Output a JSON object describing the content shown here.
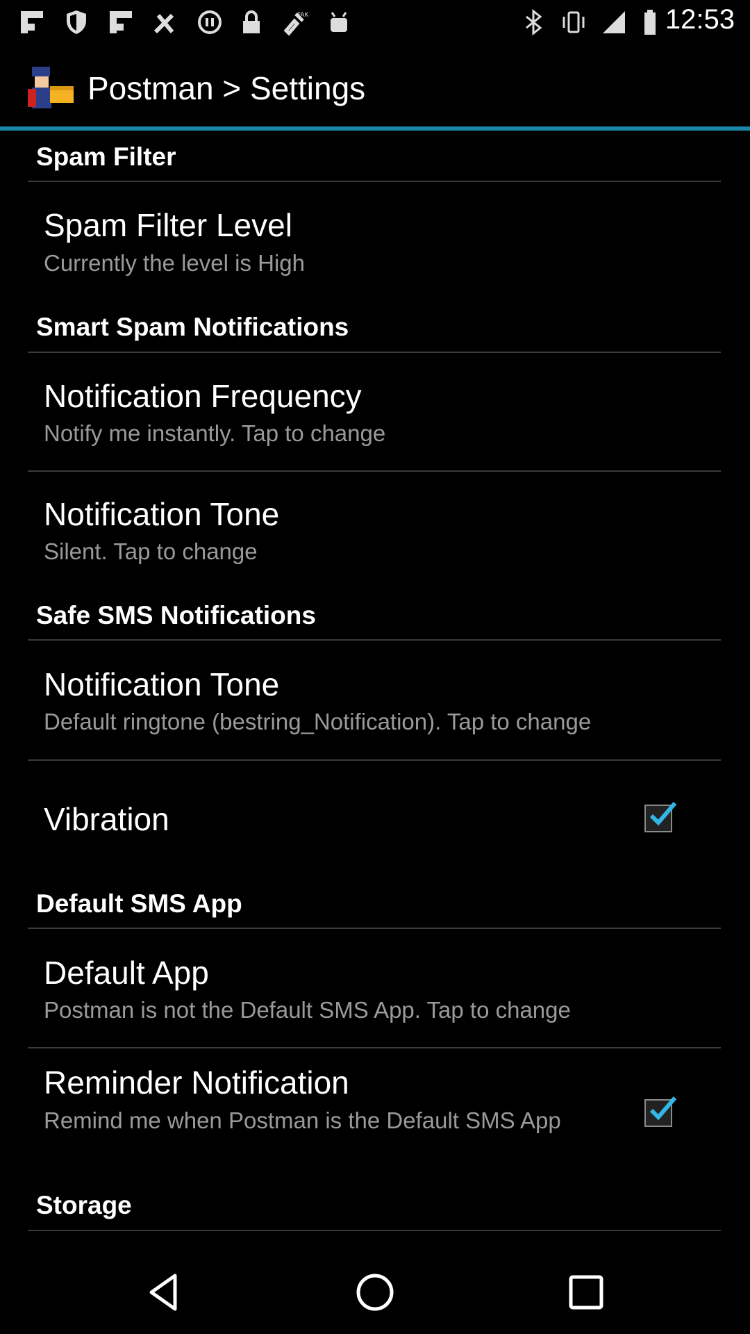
{
  "status_bar": {
    "time": "12:53",
    "icons": [
      "flipboard-icon",
      "shield-icon",
      "flipboard-icon",
      "tools-icon",
      "media-icon",
      "lock-icon",
      "fake-gps-icon",
      "android-icon",
      "bluetooth-icon",
      "vibrate-icon",
      "signal-icon",
      "battery-icon"
    ]
  },
  "action_bar": {
    "title": "Postman > Settings",
    "icon": "postman-app-icon"
  },
  "sections": {
    "spam_filter": {
      "header": "Spam Filter",
      "level_title": "Spam Filter Level",
      "level_summary": "Currently the level is High"
    },
    "smart_spam": {
      "header": "Smart Spam Notifications",
      "freq_title": "Notification Frequency",
      "freq_summary": "Notify me instantly. Tap to change",
      "tone_title": "Notification Tone",
      "tone_summary": "Silent. Tap to change"
    },
    "safe_sms": {
      "header": "Safe SMS Notifications",
      "tone_title": "Notification Tone",
      "tone_summary": "Default ringtone (bestring_Notification). Tap to change",
      "vibration_title": "Vibration",
      "vibration_checked": true
    },
    "default_sms": {
      "header": "Default SMS App",
      "app_title": "Default App",
      "app_summary": "Postman is not the Default SMS App. Tap to change",
      "reminder_title": "Reminder Notification",
      "reminder_summary": "Remind me when Postman is the Default SMS App",
      "reminder_checked": true
    },
    "storage": {
      "header": "Storage"
    }
  },
  "nav_bar": {
    "buttons": [
      "back-icon",
      "home-icon",
      "recents-icon"
    ]
  },
  "colors": {
    "accent": "#1b86a8",
    "check": "#33b5e5",
    "background": "#000000"
  }
}
